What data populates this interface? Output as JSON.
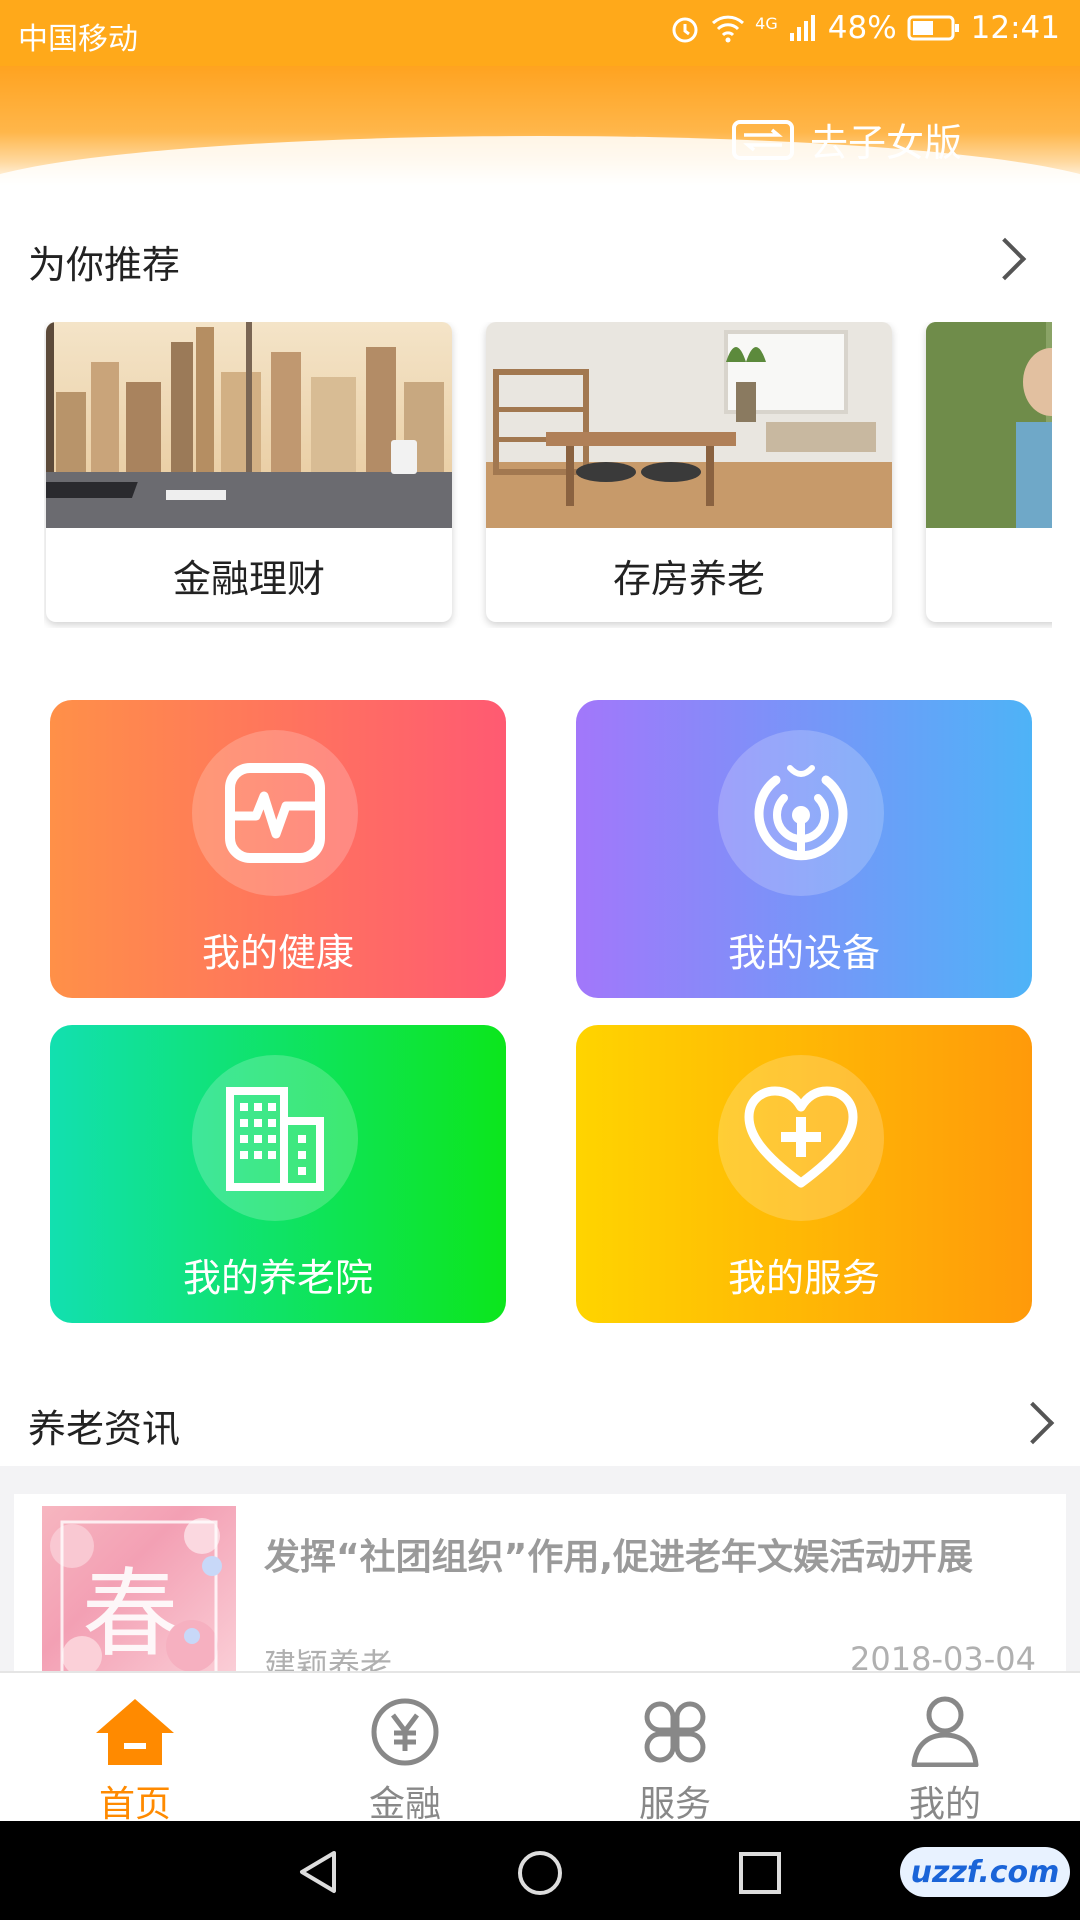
{
  "status_bar": {
    "carrier": "中国移动",
    "network": "4G",
    "battery": "48%",
    "time": "12:41"
  },
  "header": {
    "switch_label": "去子女版"
  },
  "recommend": {
    "title": "为你推荐",
    "cards": [
      {
        "label": "金融理财",
        "image": "city-office-photo"
      },
      {
        "label": "存房养老",
        "image": "living-room-photo"
      },
      {
        "label": "",
        "image": "elderly-person-photo"
      }
    ]
  },
  "tiles": [
    {
      "label": "我的健康",
      "icon": "health-monitor-icon",
      "colors": [
        "#ff9048",
        "#ff5a72"
      ]
    },
    {
      "label": "我的设备",
      "icon": "device-signal-icon",
      "colors": [
        "#a277fa",
        "#4eb3f7"
      ]
    },
    {
      "label": "我的养老院",
      "icon": "building-icon",
      "colors": [
        "#12e0b0",
        "#0ce61c"
      ]
    },
    {
      "label": "我的服务",
      "icon": "heart-plus-icon",
      "colors": [
        "#ffd400",
        "#ff9a0a"
      ]
    }
  ],
  "news": {
    "title": "养老资讯",
    "items": [
      {
        "headline": "发挥“社团组织”作用,促进老年文娱活动开展",
        "source": "建颖养老",
        "date": "2018-03-04",
        "thumb_text": "春"
      }
    ]
  },
  "bottom_nav": {
    "active_color": "#ff8a00",
    "items": [
      {
        "label": "首页",
        "icon": "home-icon",
        "active": true
      },
      {
        "label": "金融",
        "icon": "yuan-icon",
        "active": false
      },
      {
        "label": "服务",
        "icon": "grid-icon",
        "active": false
      },
      {
        "label": "我的",
        "icon": "person-icon",
        "active": false
      }
    ]
  },
  "watermark": {
    "text": "uzzf.com"
  }
}
